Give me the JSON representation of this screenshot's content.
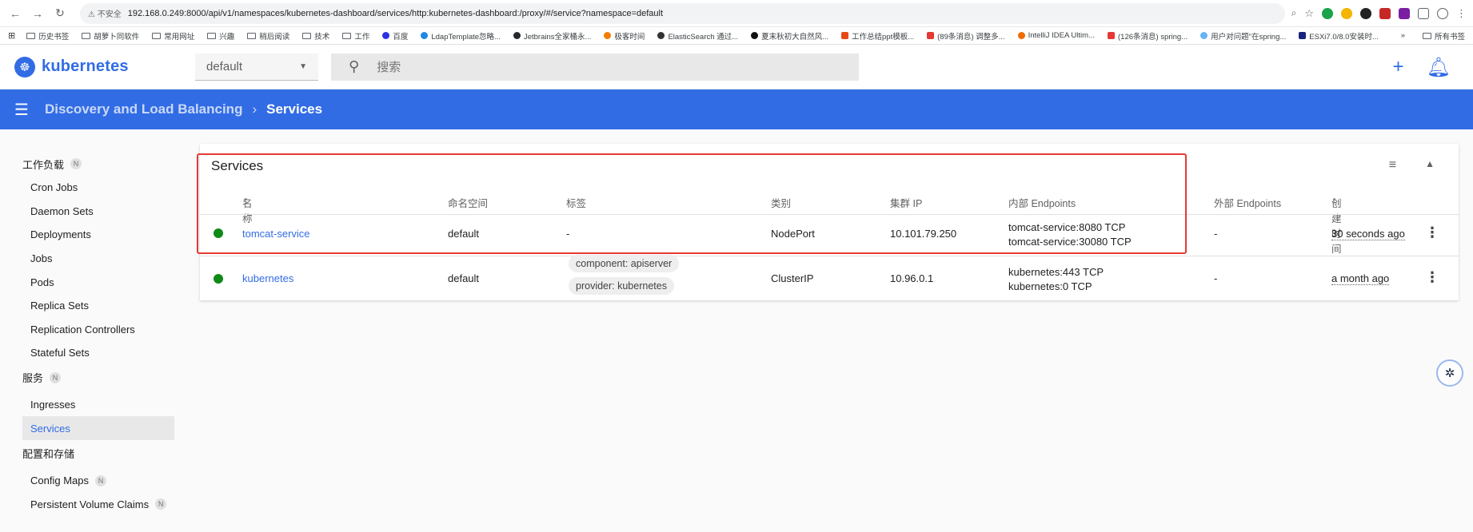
{
  "browser": {
    "insecure": "⚠ 不安全",
    "url": "192.168.0.249:8000/api/v1/namespaces/kubernetes-dashboard/services/http:kubernetes-dashboard:/proxy/#/service?namespace=default",
    "bookmarks": [
      "历史书签",
      "胡萝卜同软件",
      "常用网址",
      "兴趣",
      "稍后阅读",
      "技术",
      "工作",
      "百度",
      "LdapTemplate忽略...",
      "Jetbrains全家桶永...",
      "极客时间",
      "ElasticSearch 通过...",
      "夏末秋初大自然风...",
      "工作总结ppt模板...",
      "(89条消息) 调整多...",
      "IntelliJ IDEA Ultim...",
      "(126条消息) spring...",
      "用户对问题\"在spring...",
      "ESXi7.0/8.0安装时..."
    ],
    "all_bookmarks": "所有书签",
    "colors": {
      "blue": "#326ce5",
      "green": "#0f8a16",
      "red": "#e53935"
    }
  },
  "header": {
    "logo_text": "kubernetes",
    "logo_icon": "helm-wheel-icon",
    "namespace": "default",
    "search_placeholder": "搜索"
  },
  "breadcrumb": {
    "parent": "Discovery and Load Balancing",
    "current": "Services"
  },
  "sidebar": {
    "workloads": "工作负载",
    "badge": "N",
    "workload_items": [
      "Cron Jobs",
      "Daemon Sets",
      "Deployments",
      "Jobs",
      "Pods",
      "Replica Sets",
      "Replication Controllers",
      "Stateful Sets"
    ],
    "service_section": "服务",
    "service_items": [
      "Ingresses",
      "Services"
    ],
    "config_section": "配置和存储",
    "config_items": [
      "Config Maps",
      "Persistent Volume Claims"
    ]
  },
  "card": {
    "title": "Services",
    "columns": [
      "名称",
      "命名空间",
      "标签",
      "类别",
      "集群 IP",
      "内部 Endpoints",
      "外部 Endpoints",
      "创建时间"
    ],
    "rows": [
      {
        "name": "tomcat-service",
        "namespace": "default",
        "labels": "-",
        "type": "NodePort",
        "cluster_ip": "10.101.79.250",
        "ep1": "tomcat-service:8080 TCP",
        "ep2": "tomcat-service:30080 TCP",
        "external": "-",
        "age": "30 seconds ago"
      },
      {
        "name": "kubernetes",
        "namespace": "default",
        "label1": "component: apiserver",
        "label2": "provider: kubernetes",
        "type": "ClusterIP",
        "cluster_ip": "10.96.0.1",
        "ep1": "kubernetes:443 TCP",
        "ep2": "kubernetes:0 TCP",
        "external": "-",
        "age": "a month ago"
      }
    ]
  }
}
